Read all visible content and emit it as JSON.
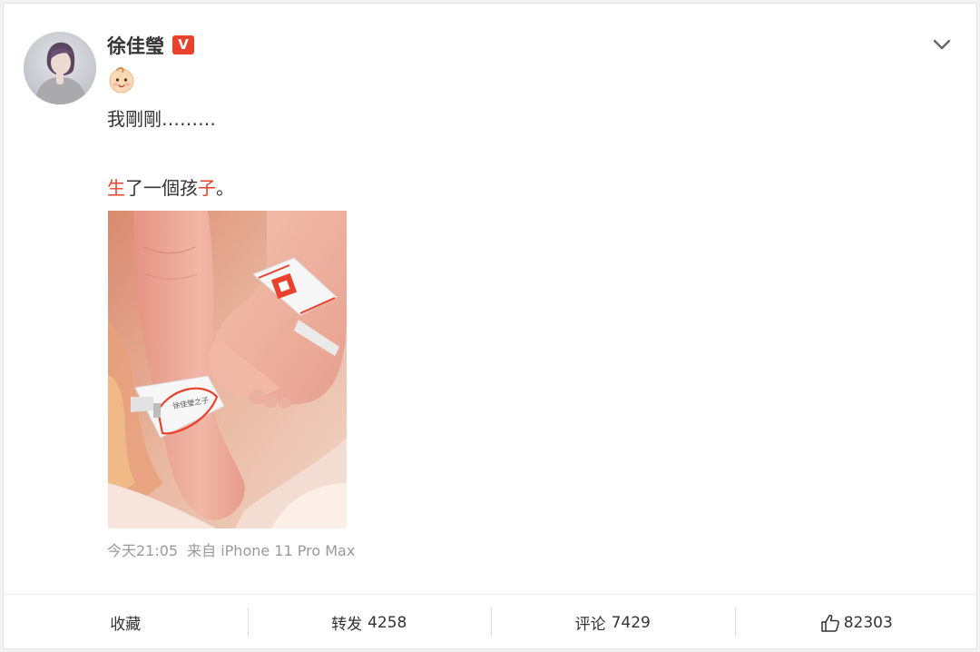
{
  "post": {
    "username": "徐佳瑩",
    "verified_badge": "V",
    "emoji": "baby-face-emoji",
    "line1": "我剛剛………",
    "line2_parts": [
      "生",
      "了一個孩",
      "子",
      "。"
    ],
    "photo": "newborn-feet-with-hospital-id-bands",
    "time": "今天21:05",
    "source": "来自 iPhone 11 Pro Max",
    "accent_color": "#e8412c"
  },
  "actions": {
    "favorite_label": "收藏",
    "repost_label": "转发",
    "repost_count": "4258",
    "comment_label": "评论",
    "comment_count": "7429",
    "like_count": "82303"
  }
}
